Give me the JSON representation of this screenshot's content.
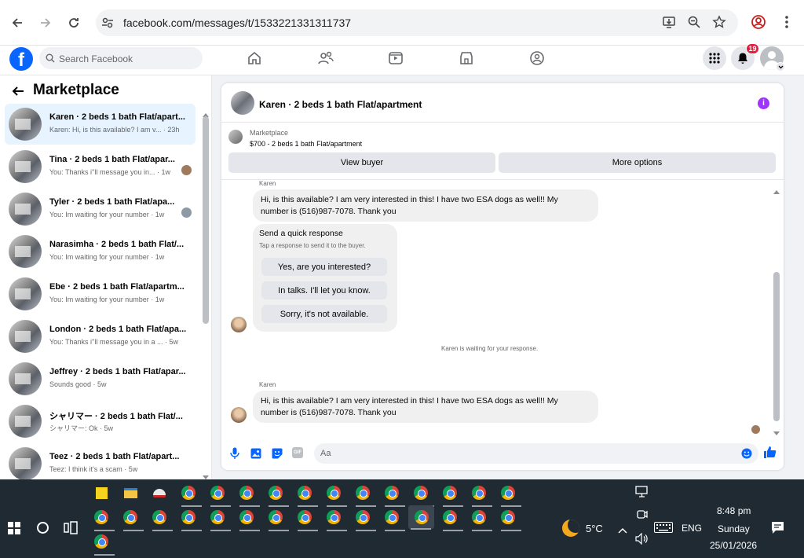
{
  "browser": {
    "url": "facebook.com/messages/t/1533221331311737"
  },
  "fb": {
    "search_placeholder": "Search Facebook",
    "notif_count": "19"
  },
  "sidebar": {
    "title": "Marketplace",
    "items": [
      {
        "name": "Karen · 2 beds 1 bath Flat/apart...",
        "preview": "Karen: Hi, is this available? I am v... · 23h",
        "active": true
      },
      {
        "name": "Tina · 2 beds 1 bath Flat/apar...",
        "preview": "You: Thanks i''ll message you in... · 1w"
      },
      {
        "name": "Tyler · 2 beds 1 bath Flat/apa...",
        "preview": "You: Im waiting for your number · 1w"
      },
      {
        "name": "Narasimha · 2 beds 1 bath Flat/...",
        "preview": "You: Im waiting for your number · 1w"
      },
      {
        "name": "Ebe · 2 beds 1 bath Flat/apartm...",
        "preview": "You: Im waiting for your number · 1w"
      },
      {
        "name": "London · 2 beds 1 bath Flat/apa...",
        "preview": "You: Thanks i''ll message you in a ... · 5w"
      },
      {
        "name": "Jeffrey · 2 beds 1 bath Flat/apar...",
        "preview": "Sounds good · 5w"
      },
      {
        "name": "シャリマー · 2 beds 1 bath Flat/...",
        "preview": "シャリマー: Ok · 5w"
      },
      {
        "name": "Teez · 2 beds 1 bath Flat/apart...",
        "preview": "Teez: I think it's a scam · 5w"
      }
    ]
  },
  "chat": {
    "title": "Karen · 2 beds 1 bath Flat/apartment",
    "marketplace_label": "Marketplace",
    "listing": "$700 - 2 beds 1 bath Flat/apartment",
    "view_buyer": "View buyer",
    "more_options": "More options",
    "sender": "Karen",
    "message1_line1": "Hi, is this available? I am very interested in this! I have two ESA dogs as well!! My",
    "message1_line2": "number is (516)987-7078. Thank you",
    "quick_title": "Send a quick response",
    "quick_sub": "Tap a response to send it to the buyer.",
    "quick_options": [
      "Yes, are you interested?",
      "In talks. I'll let you know.",
      "Sorry, it's not available."
    ],
    "waiting": "Karen is waiting for your response.",
    "sender2": "Karen",
    "message2_line1": "Hi, is this available? I am very interested in this! I have two ESA dogs as well!! My",
    "message2_line2": "number is (516)987-7078. Thank you",
    "composer_placeholder": "Aa"
  },
  "taskbar": {
    "weather": "5°C",
    "lang": "ENG",
    "time": "8:48 pm",
    "day": "Sunday",
    "date": "25/01/2026"
  }
}
